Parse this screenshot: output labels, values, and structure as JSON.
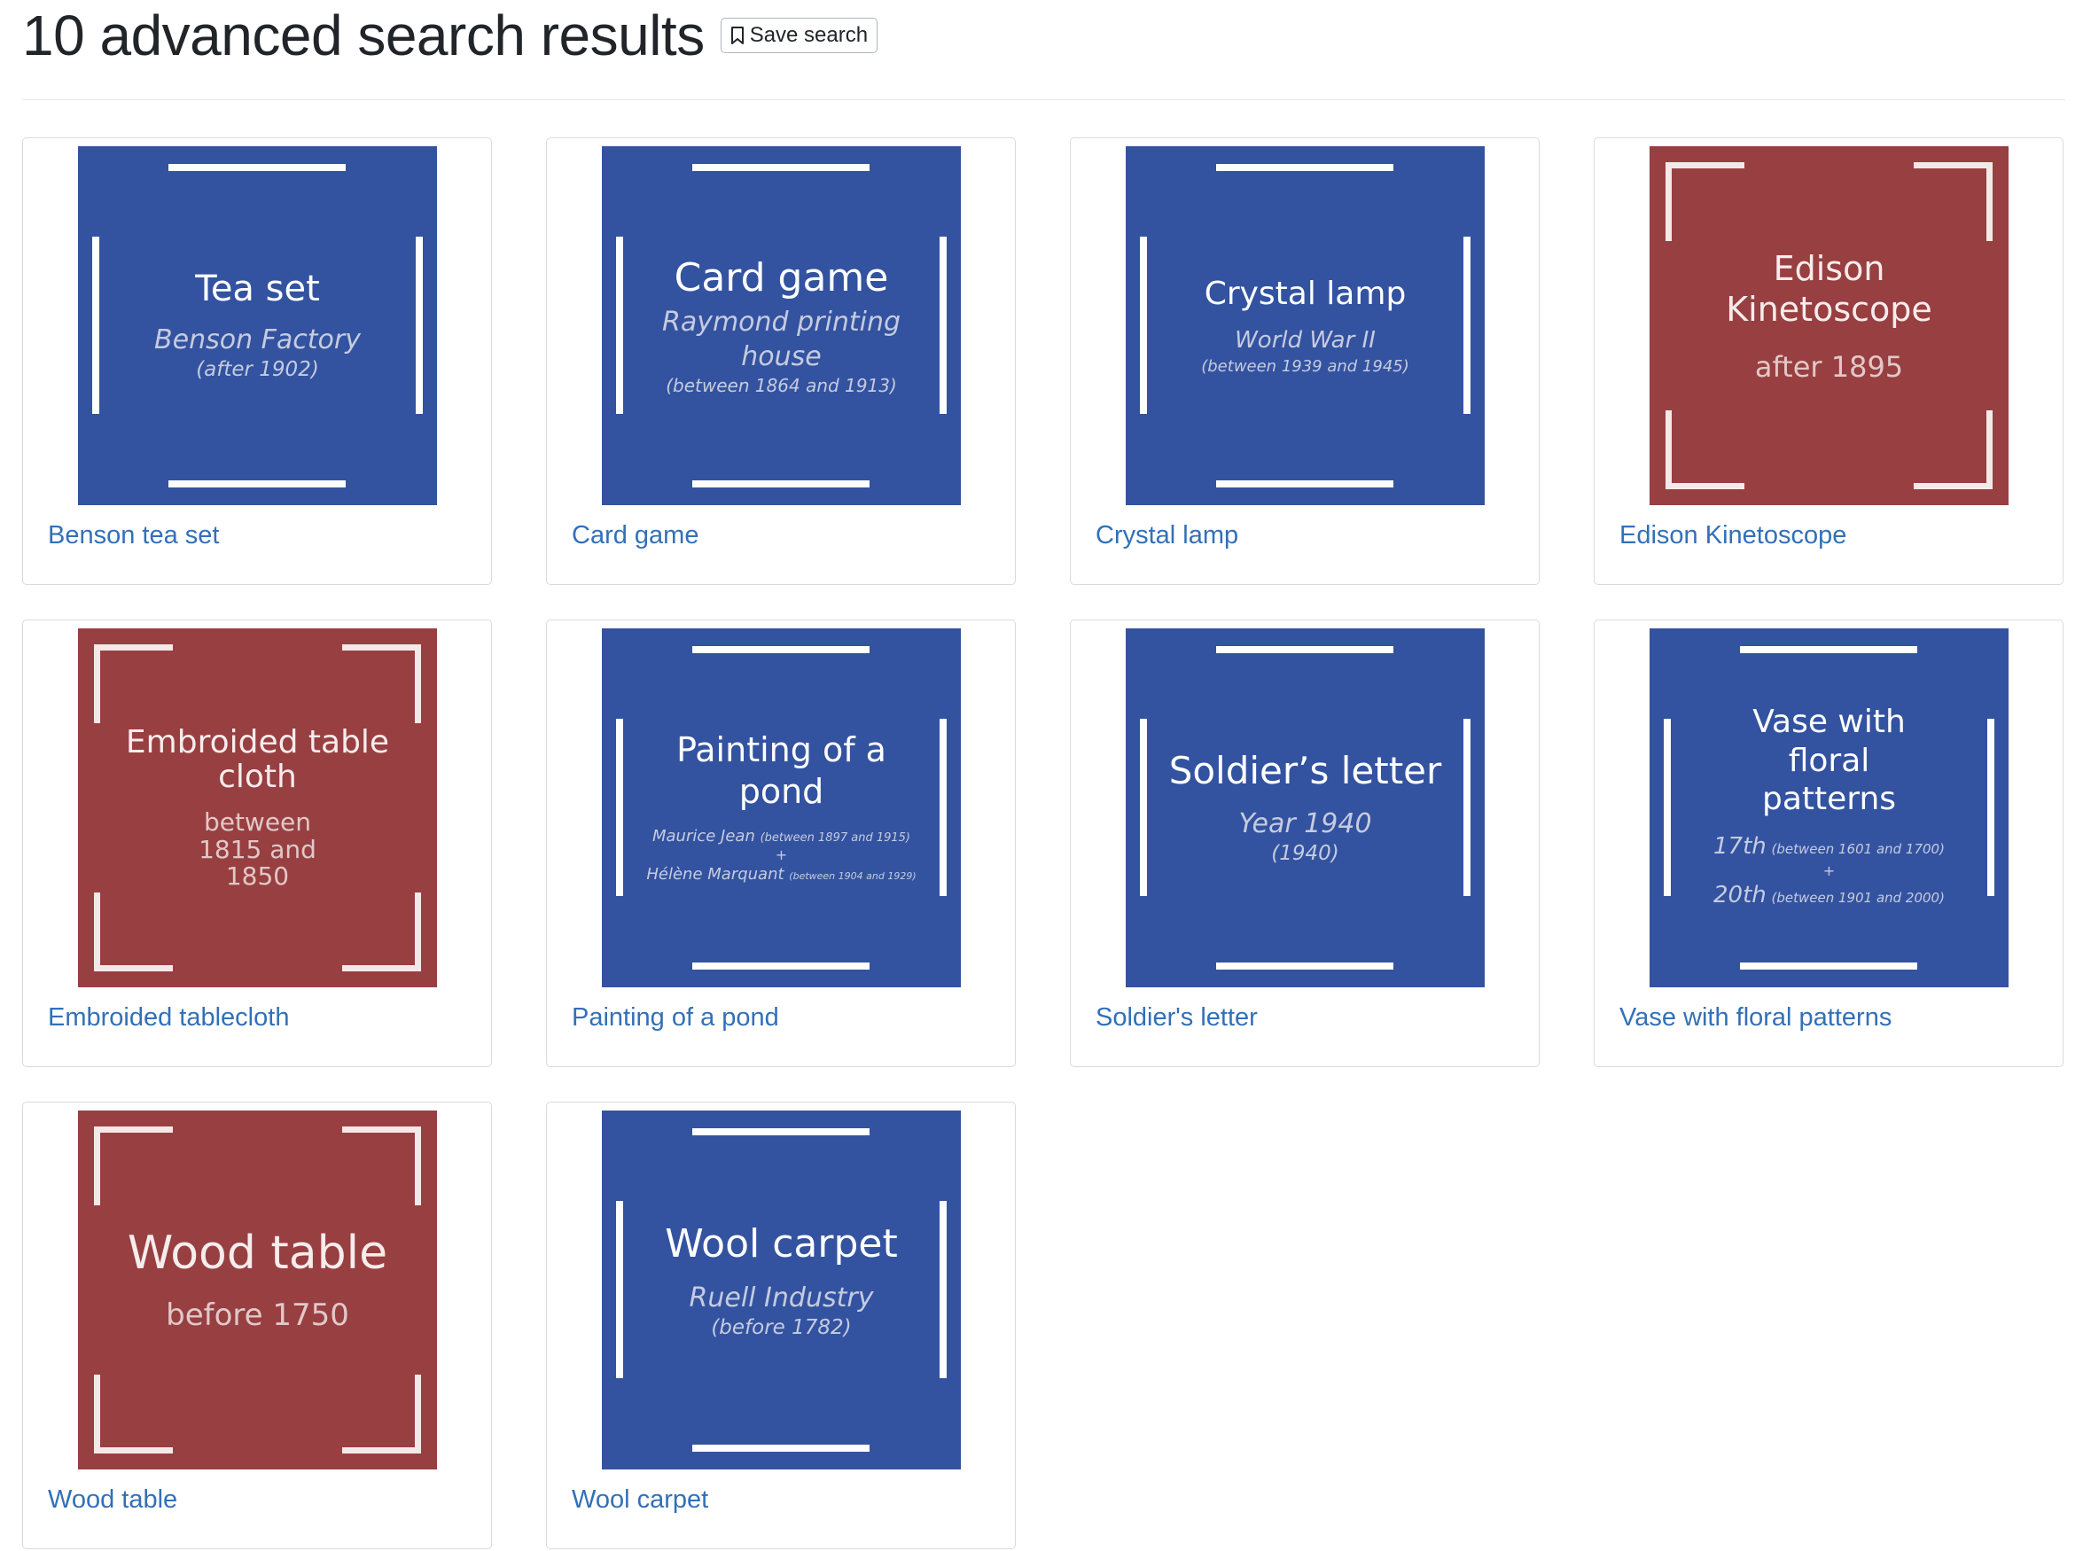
{
  "header": {
    "title": "10 advanced search results",
    "save_label": "Save search"
  },
  "colors": {
    "blue_tile": "#3353a0",
    "red_tile": "#983f41",
    "link": "#3270b8"
  },
  "results": [
    {
      "link": "Benson tea set",
      "tile": "blue",
      "title": "Tea set",
      "maker": "Benson Factory",
      "date": "(after 1902)"
    },
    {
      "link": "Card game",
      "tile": "blue",
      "title": "Card game",
      "maker": "Raymond printing house",
      "date": "(between 1864 and 1913)"
    },
    {
      "link": "Crystal lamp",
      "tile": "blue",
      "title": "Crystal lamp",
      "maker": "World War II",
      "date": "(between 1939 and 1945)"
    },
    {
      "link": "Edison Kinetoscope",
      "tile": "red",
      "title": "Edison Kinetoscope",
      "subtitle": "after 1895"
    },
    {
      "link": "Embroided tablecloth",
      "tile": "red",
      "title": "Embroided table cloth",
      "subtitle": "between 1815 and 1850"
    },
    {
      "link": "Painting of a pond",
      "tile": "blue",
      "title": "Painting of a pond",
      "maker1": "Maurice Jean",
      "date1": "(between 1897 and 1915)",
      "plus": "+",
      "maker2": "Hélène Marquant",
      "date2": "(between 1904 and 1929)"
    },
    {
      "link": "Soldier's letter",
      "tile": "blue",
      "title": "Soldier’s letter",
      "maker": "Year 1940",
      "date": "(1940)"
    },
    {
      "link": "Vase with floral patterns",
      "tile": "blue",
      "title": "Vase with floral patterns",
      "maker1": "17th",
      "date1": "(between 1601 and 1700)",
      "plus": "+",
      "maker2": "20th",
      "date2": "(between 1901 and 2000)"
    },
    {
      "link": "Wood table",
      "tile": "red",
      "title": "Wood table",
      "subtitle": "before 1750"
    },
    {
      "link": "Wool carpet",
      "tile": "blue",
      "title": "Wool carpet",
      "maker": "Ruell Industry",
      "date": "(before 1782)"
    }
  ]
}
